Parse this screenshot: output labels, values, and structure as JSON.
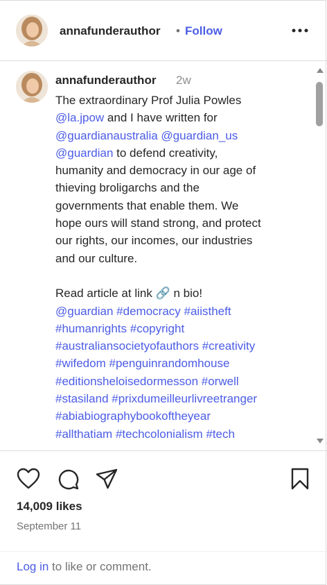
{
  "header": {
    "username": "annafunderauthor",
    "separator": "•",
    "follow_label": "Follow"
  },
  "caption": {
    "username": "annafunderauthor",
    "time": "2w",
    "lines": [
      [
        {
          "t": "The extraordinary Prof Julia Powles"
        }
      ],
      [
        {
          "t": "@la.jpow",
          "tag": true
        },
        {
          "t": " and I have written for"
        }
      ],
      [
        {
          "t": "@guardianaustralia",
          "tag": true
        },
        {
          "t": " "
        },
        {
          "t": "@guardian_us",
          "tag": true
        }
      ],
      [
        {
          "t": "@guardian",
          "tag": true
        },
        {
          "t": " to defend creativity,"
        }
      ],
      [
        {
          "t": "humanity and democracy in our age of"
        }
      ],
      [
        {
          "t": "thieving broligarchs and the"
        }
      ],
      [
        {
          "t": "governments that enable them. We"
        }
      ],
      [
        {
          "t": "hope ours will stand strong, and protect"
        }
      ],
      [
        {
          "t": "our rights, our incomes, our industries"
        }
      ],
      [
        {
          "t": "and our culture."
        }
      ],
      [],
      [
        {
          "t": "Read article at link 🔗 n bio!"
        }
      ],
      [
        {
          "t": "@guardian",
          "tag": true
        },
        {
          "t": " "
        },
        {
          "t": "#democracy",
          "tag": true
        },
        {
          "t": " "
        },
        {
          "t": "#aiistheft",
          "tag": true
        }
      ],
      [
        {
          "t": "#humanrights",
          "tag": true
        },
        {
          "t": " "
        },
        {
          "t": "#copyright",
          "tag": true
        }
      ],
      [
        {
          "t": "#australiansocietyofauthors",
          "tag": true
        },
        {
          "t": " "
        },
        {
          "t": "#creativity",
          "tag": true
        }
      ],
      [
        {
          "t": "#wifedom",
          "tag": true
        },
        {
          "t": " "
        },
        {
          "t": "#penguinrandomhouse",
          "tag": true
        }
      ],
      [
        {
          "t": "#editionsheloisedormesson",
          "tag": true
        },
        {
          "t": " "
        },
        {
          "t": "#orwell",
          "tag": true
        }
      ],
      [
        {
          "t": "#stasiland",
          "tag": true
        },
        {
          "t": " "
        },
        {
          "t": "#prixdumeilleurlivreetranger",
          "tag": true
        }
      ],
      [
        {
          "t": "#abiabiographybookoftheyear",
          "tag": true
        }
      ],
      [
        {
          "t": "#allthatiam",
          "tag": true
        },
        {
          "t": " "
        },
        {
          "t": "#techcolonialism",
          "tag": true
        },
        {
          "t": " "
        },
        {
          "t": "#tech",
          "tag": true
        }
      ]
    ]
  },
  "actions": {
    "likes": "14,009 likes",
    "date": "September 11",
    "login_label": "Log in",
    "login_suffix": " to like or comment."
  },
  "icons": {
    "like": "heart-icon",
    "comment": "comment-icon",
    "share": "share-icon",
    "save": "bookmark-icon",
    "more": "more-options-icon"
  },
  "colors": {
    "link": "#4b5ce6",
    "text": "#262626",
    "muted": "#737373"
  }
}
